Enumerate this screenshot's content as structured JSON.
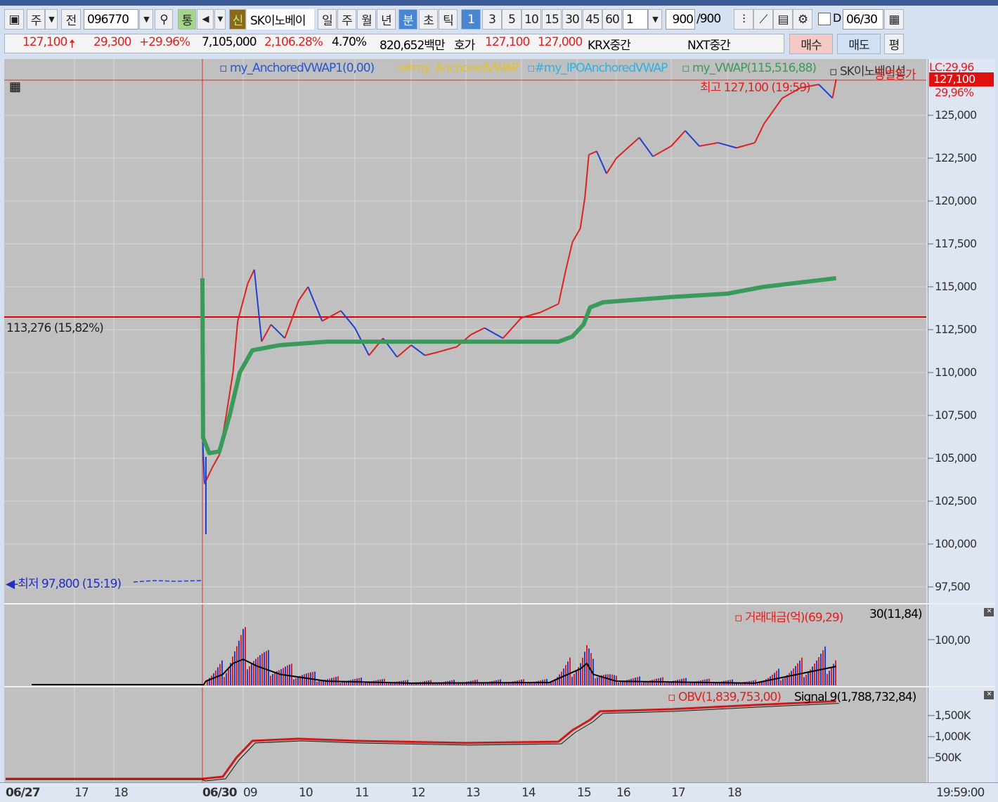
{
  "toolbar": {
    "market": "주",
    "prev": "전",
    "code": "096770",
    "tong": "통",
    "sin": "신",
    "name": "SK이노베이",
    "periods": [
      "일",
      "주",
      "월",
      "년",
      "분",
      "초",
      "틱"
    ],
    "intervals": [
      "1",
      "3",
      "5",
      "10",
      "15",
      "30",
      "45",
      "60"
    ],
    "multiplier": "1",
    "count": "900",
    "count_total": "/900",
    "d_label": "D",
    "date": "06/30"
  },
  "quote": {
    "price": "127,100",
    "change": "29,300",
    "change_pct": "+29.96%",
    "volume": "7,105,000",
    "volume_pct": "2,106.28%",
    "turnover": "4.70%",
    "amount": "820,652백만",
    "hoga_label": "호가",
    "ask": "127,100",
    "bid": "127,000",
    "krx": "KRX중간",
    "nxt": "NXT중간",
    "buy": "매수",
    "sell": "매도",
    "avg": "평"
  },
  "legend": {
    "avwap1": "my_AnchoredVWAP1(0,00)",
    "avwap": "#my_AnchoredVWAP",
    "ipo": "#my_IPOAnchoredVWAP",
    "vwap": "my_VWAP(115,516,88)",
    "stock": "SK이노베이션",
    "sim": "동별동가",
    "lc": "LC:29,96",
    "last": "127,100",
    "last_pct": "29,96%"
  },
  "annotations": {
    "high": "최고 127,100 (19:59)",
    "low": "최저 97,800 (15:19)",
    "hline": "113,276 (15,82%)"
  },
  "price_axis": [
    "125,000",
    "122,500",
    "120,000",
    "117,500",
    "115,000",
    "112,500",
    "110,000",
    "107,500",
    "105,000",
    "102,500",
    "100,000",
    "97,500"
  ],
  "volume_panel": {
    "legend": "거래대금(억)(69,29)",
    "ma": "30(11,84)",
    "axis": "100,00"
  },
  "obv_panel": {
    "legend": "OBV(1,839,753,00)",
    "signal": "Signal 9(1,788,732,84)",
    "axis": [
      "1,500K",
      "1,000K",
      "500K"
    ]
  },
  "time_axis": [
    "06/27",
    "17",
    "18",
    "06/30",
    "09",
    "10",
    "11",
    "12",
    "13",
    "14",
    "15",
    "16",
    "17",
    "18",
    "19:59:00"
  ],
  "colors": {
    "up": "#e02020",
    "down": "#2040d0",
    "vwap": "#3a9a5a",
    "hline": "#e00000"
  },
  "price_series": [
    [
      "08:00",
      106500
    ],
    [
      "08:03",
      103500
    ],
    [
      "08:15",
      104500
    ],
    [
      "08:25",
      105200
    ],
    [
      "08:35",
      107500
    ],
    [
      "08:45",
      110000
    ],
    [
      "08:52",
      113000
    ],
    [
      "09:05",
      115200
    ],
    [
      "09:12",
      116000
    ],
    [
      "09:20",
      111800
    ],
    [
      "09:30",
      112800
    ],
    [
      "09:45",
      112000
    ],
    [
      "10:00",
      114200
    ],
    [
      "10:10",
      115000
    ],
    [
      "10:25",
      113000
    ],
    [
      "10:45",
      113600
    ],
    [
      "11:00",
      112600
    ],
    [
      "11:15",
      111000
    ],
    [
      "11:30",
      112000
    ],
    [
      "11:45",
      110900
    ],
    [
      "12:00",
      111600
    ],
    [
      "12:15",
      111000
    ],
    [
      "12:30",
      111200
    ],
    [
      "12:50",
      111500
    ],
    [
      "13:05",
      112200
    ],
    [
      "13:20",
      112600
    ],
    [
      "13:40",
      112000
    ],
    [
      "14:00",
      113200
    ],
    [
      "14:20",
      113500
    ],
    [
      "14:40",
      114000
    ],
    [
      "14:48",
      116000
    ],
    [
      "14:55",
      117600
    ],
    [
      "15:05",
      118400
    ],
    [
      "15:12",
      120200
    ],
    [
      "15:18",
      122700
    ],
    [
      "15:30",
      122900
    ],
    [
      "15:45",
      121600
    ],
    [
      "16:00",
      122500
    ],
    [
      "16:25",
      123700
    ],
    [
      "16:40",
      122600
    ],
    [
      "17:00",
      123200
    ],
    [
      "17:15",
      124100
    ],
    [
      "17:30",
      123200
    ],
    [
      "17:50",
      123400
    ],
    [
      "18:10",
      123100
    ],
    [
      "18:30",
      123400
    ],
    [
      "18:40",
      124500
    ],
    [
      "19:00",
      126000
    ],
    [
      "19:20",
      126600
    ],
    [
      "19:40",
      126800
    ],
    [
      "19:55",
      126000
    ],
    [
      "19:59",
      127100
    ]
  ],
  "vwap_series": [
    [
      "08:00",
      115500
    ],
    [
      "08:01",
      106200
    ],
    [
      "08:10",
      105300
    ],
    [
      "08:25",
      105400
    ],
    [
      "08:40",
      107500
    ],
    [
      "08:55",
      110000
    ],
    [
      "09:10",
      111300
    ],
    [
      "09:40",
      111600
    ],
    [
      "10:30",
      111800
    ],
    [
      "13:30",
      111800
    ],
    [
      "14:40",
      111800
    ],
    [
      "14:55",
      112100
    ],
    [
      "15:10",
      112800
    ],
    [
      "15:20",
      113800
    ],
    [
      "15:40",
      114100
    ],
    [
      "17:00",
      114400
    ],
    [
      "18:00",
      114600
    ],
    [
      "18:40",
      115000
    ],
    [
      "19:59",
      115500
    ]
  ],
  "volume_series": [
    [
      "08:05",
      15
    ],
    [
      "08:30",
      40
    ],
    [
      "08:45",
      80
    ],
    [
      "09:00",
      95
    ],
    [
      "09:15",
      70
    ],
    [
      "09:40",
      40
    ],
    [
      "10:30",
      15
    ],
    [
      "12:00",
      8
    ],
    [
      "14:30",
      10
    ],
    [
      "14:50",
      40
    ],
    [
      "15:05",
      60
    ],
    [
      "15:15",
      80
    ],
    [
      "15:25",
      40
    ],
    [
      "16:00",
      15
    ],
    [
      "18:30",
      8
    ],
    [
      "19:59",
      69
    ]
  ],
  "obv_series": [
    [
      "08:00",
      0
    ],
    [
      "08:30",
      50000
    ],
    [
      "08:50",
      500000
    ],
    [
      "09:10",
      900000
    ],
    [
      "10:00",
      950000
    ],
    [
      "11:00",
      900000
    ],
    [
      "13:00",
      850000
    ],
    [
      "14:40",
      880000
    ],
    [
      "14:55",
      1150000
    ],
    [
      "15:20",
      1400000
    ],
    [
      "15:35",
      1600000
    ],
    [
      "17:00",
      1650000
    ],
    [
      "18:30",
      1750000
    ],
    [
      "19:59",
      1840000
    ]
  ]
}
